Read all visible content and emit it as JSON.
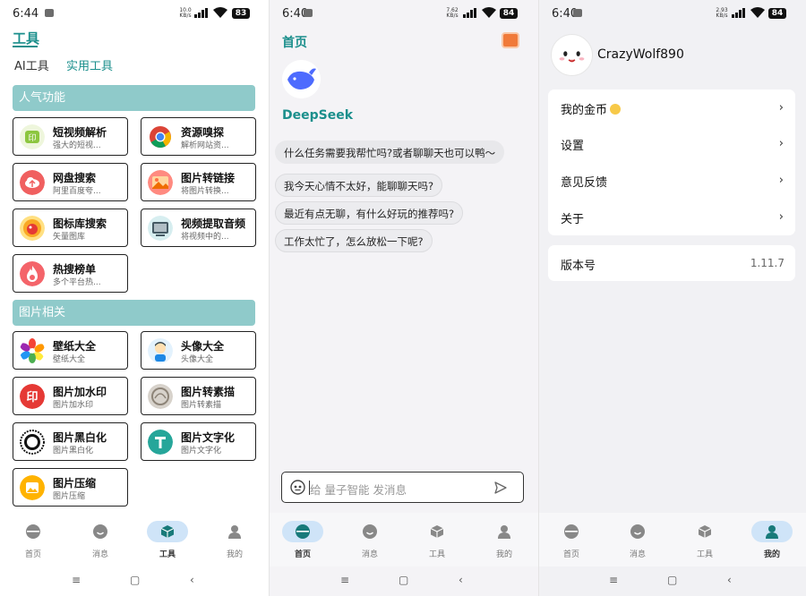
{
  "colors": {
    "accent": "#1b8f8c",
    "section": "#8fcaca",
    "nav_active": "#cfe4f8"
  },
  "screens": [
    {
      "status": {
        "time": "6:44",
        "speed_top": "10.0",
        "speed_bottom": "KB/s",
        "battery": "83"
      },
      "title": "工具",
      "subtabs": [
        {
          "label": "AI工具"
        },
        {
          "label": "实用工具"
        }
      ],
      "sections": [
        {
          "title": "人气功能",
          "items": [
            {
              "title": "短视频解析",
              "subtitle": "强大的短视...",
              "icon": "video-parse-icon"
            },
            {
              "title": "资源嗅探",
              "subtitle": "解析网站资...",
              "icon": "chrome-icon"
            },
            {
              "title": "网盘搜索",
              "subtitle": "阿里百度夸...",
              "icon": "cloud-icon"
            },
            {
              "title": "图片转链接",
              "subtitle": "将图片转换...",
              "icon": "image-link-icon"
            },
            {
              "title": "图标库搜索",
              "subtitle": "矢量图库",
              "icon": "icon-library-icon"
            },
            {
              "title": "视频提取音频",
              "subtitle": "将视频中的...",
              "icon": "audio-extract-icon"
            },
            {
              "title": "热搜榜单",
              "subtitle": "多个平台热...",
              "icon": "fire-icon"
            }
          ]
        },
        {
          "title": "图片相关",
          "items": [
            {
              "title": "壁纸大全",
              "subtitle": "壁纸大全",
              "icon": "wallpaper-icon"
            },
            {
              "title": "头像大全",
              "subtitle": "头像大全",
              "icon": "avatar-icon"
            },
            {
              "title": "图片加水印",
              "subtitle": "图片加水印",
              "icon": "watermark-icon"
            },
            {
              "title": "图片转素描",
              "subtitle": "图片转素描",
              "icon": "sketch-icon"
            },
            {
              "title": "图片黑白化",
              "subtitle": "图片黑白化",
              "icon": "bw-icon"
            },
            {
              "title": "图片文字化",
              "subtitle": "图片文字化",
              "icon": "text-icon"
            },
            {
              "title": "图片压缩",
              "subtitle": "图片压缩",
              "icon": "compress-icon"
            }
          ]
        }
      ]
    },
    {
      "status": {
        "time": "6:40",
        "speed_top": "7.62",
        "speed_bottom": "KB/s",
        "battery": "84"
      },
      "title": "首页",
      "bot_name": "DeepSeek",
      "messages": [
        "什么任务需要我帮忙吗?或者聊聊天也可以鸭～",
        "我今天心情不太好，能聊聊天吗?",
        "最近有点无聊，有什么好玩的推荐吗?",
        "工作太忙了，怎么放松一下呢?"
      ],
      "input_placeholder": "给 量子智能 发消息"
    },
    {
      "status": {
        "time": "6:40",
        "speed_top": "2.93",
        "speed_bottom": "KB/s",
        "battery": "84"
      },
      "username": "CrazyWolf890",
      "menu": [
        {
          "label": "我的金币"
        },
        {
          "label": "设置"
        },
        {
          "label": "意见反馈"
        },
        {
          "label": "关于"
        }
      ],
      "version": {
        "label": "版本号",
        "value": "1.11.7"
      }
    }
  ],
  "nav": [
    {
      "label": "首页",
      "icon": "home-icon"
    },
    {
      "label": "消息",
      "icon": "message-icon"
    },
    {
      "label": "工具",
      "icon": "tools-icon"
    },
    {
      "label": "我的",
      "icon": "profile-icon"
    }
  ],
  "sysnav": {
    "menu": "≡",
    "home": "▢",
    "back": "‹"
  }
}
